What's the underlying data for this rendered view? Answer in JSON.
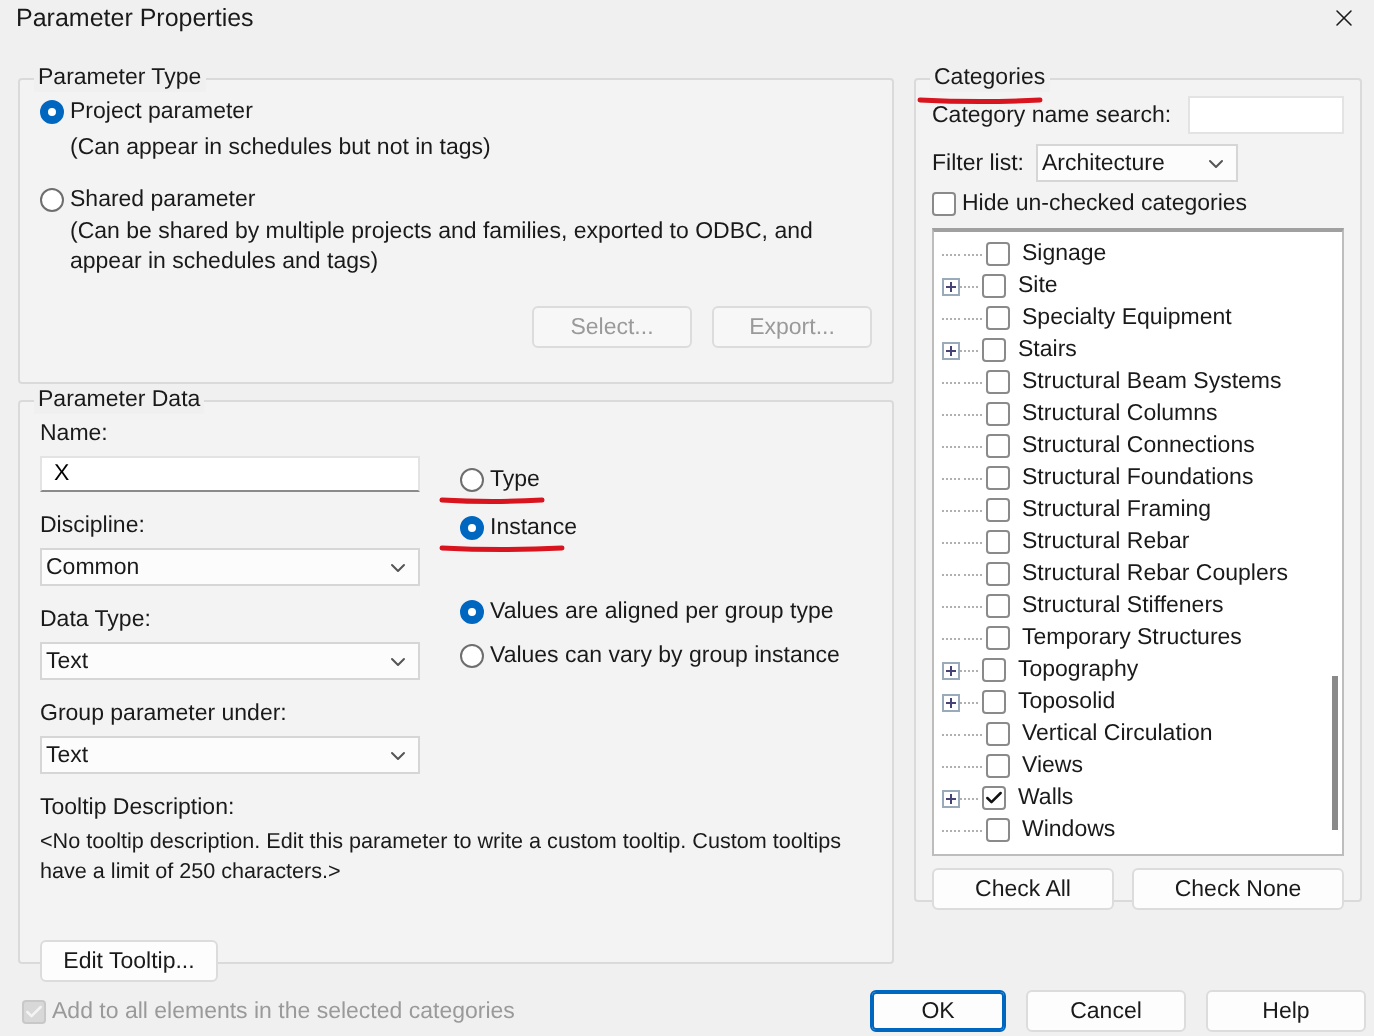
{
  "window": {
    "title": "Parameter Properties"
  },
  "parameter_type": {
    "legend": "Parameter Type",
    "options": [
      {
        "label": "Project parameter",
        "note": "(Can appear in schedules but not in tags)",
        "selected": true
      },
      {
        "label": "Shared parameter",
        "note": "(Can be shared by multiple projects and families, exported to ODBC, and appear in schedules and tags)",
        "selected": false
      }
    ],
    "buttons": [
      {
        "label": "Select...",
        "disabled": true
      },
      {
        "label": "Export...",
        "disabled": true
      }
    ]
  },
  "parameter_data": {
    "legend": "Parameter Data",
    "name": {
      "label": "Name:",
      "value": "X"
    },
    "discipline": {
      "label": "Discipline:",
      "value": "Common"
    },
    "data_type": {
      "label": "Data Type:",
      "value": "Text"
    },
    "group_under": {
      "label": "Group parameter under:",
      "value": "Text"
    },
    "type_options": [
      {
        "label": "Type",
        "selected": false,
        "underlined": true
      },
      {
        "label": "Instance",
        "selected": true,
        "underlined": true
      }
    ],
    "group_options": [
      {
        "label": "Values are aligned per group type",
        "selected": true
      },
      {
        "label": "Values can vary by group instance",
        "selected": false
      }
    ],
    "tooltip": {
      "label": "Tooltip Description:",
      "text": "<No tooltip description. Edit this parameter to write a custom tooltip. Custom tooltips have a limit of 250 characters.>"
    },
    "edit_button": "Edit Tooltip..."
  },
  "add_to_all": {
    "label": "Add to all elements in the selected categories",
    "checked": true,
    "disabled": true
  },
  "categories": {
    "legend": "Categories",
    "underlined": true,
    "search_label": "Category name search:",
    "filter_label": "Filter list:",
    "filter_value": "Architecture",
    "hide_unchecked": {
      "label": "Hide un-checked categories",
      "checked": false
    },
    "items": [
      {
        "label": "Signage",
        "checked": false,
        "expandable": false
      },
      {
        "label": "Site",
        "checked": false,
        "expandable": true
      },
      {
        "label": "Specialty Equipment",
        "checked": false,
        "expandable": false
      },
      {
        "label": "Stairs",
        "checked": false,
        "expandable": true
      },
      {
        "label": "Structural Beam Systems",
        "checked": false,
        "expandable": false
      },
      {
        "label": "Structural Columns",
        "checked": false,
        "expandable": false
      },
      {
        "label": "Structural Connections",
        "checked": false,
        "expandable": false
      },
      {
        "label": "Structural Foundations",
        "checked": false,
        "expandable": false
      },
      {
        "label": "Structural Framing",
        "checked": false,
        "expandable": false
      },
      {
        "label": "Structural Rebar",
        "checked": false,
        "expandable": false
      },
      {
        "label": "Structural Rebar Couplers",
        "checked": false,
        "expandable": false
      },
      {
        "label": "Structural Stiffeners",
        "checked": false,
        "expandable": false
      },
      {
        "label": "Temporary Structures",
        "checked": false,
        "expandable": false
      },
      {
        "label": "Topography",
        "checked": false,
        "expandable": true
      },
      {
        "label": "Toposolid",
        "checked": false,
        "expandable": true
      },
      {
        "label": "Vertical Circulation",
        "checked": false,
        "expandable": false
      },
      {
        "label": "Views",
        "checked": false,
        "expandable": false
      },
      {
        "label": "Walls",
        "checked": true,
        "expandable": true
      },
      {
        "label": "Windows",
        "checked": false,
        "expandable": false
      }
    ],
    "check_all": "Check All",
    "check_none": "Check None"
  },
  "footer_buttons": [
    {
      "label": "OK",
      "default": true
    },
    {
      "label": "Cancel",
      "default": false
    },
    {
      "label": "Help",
      "default": false
    }
  ]
}
